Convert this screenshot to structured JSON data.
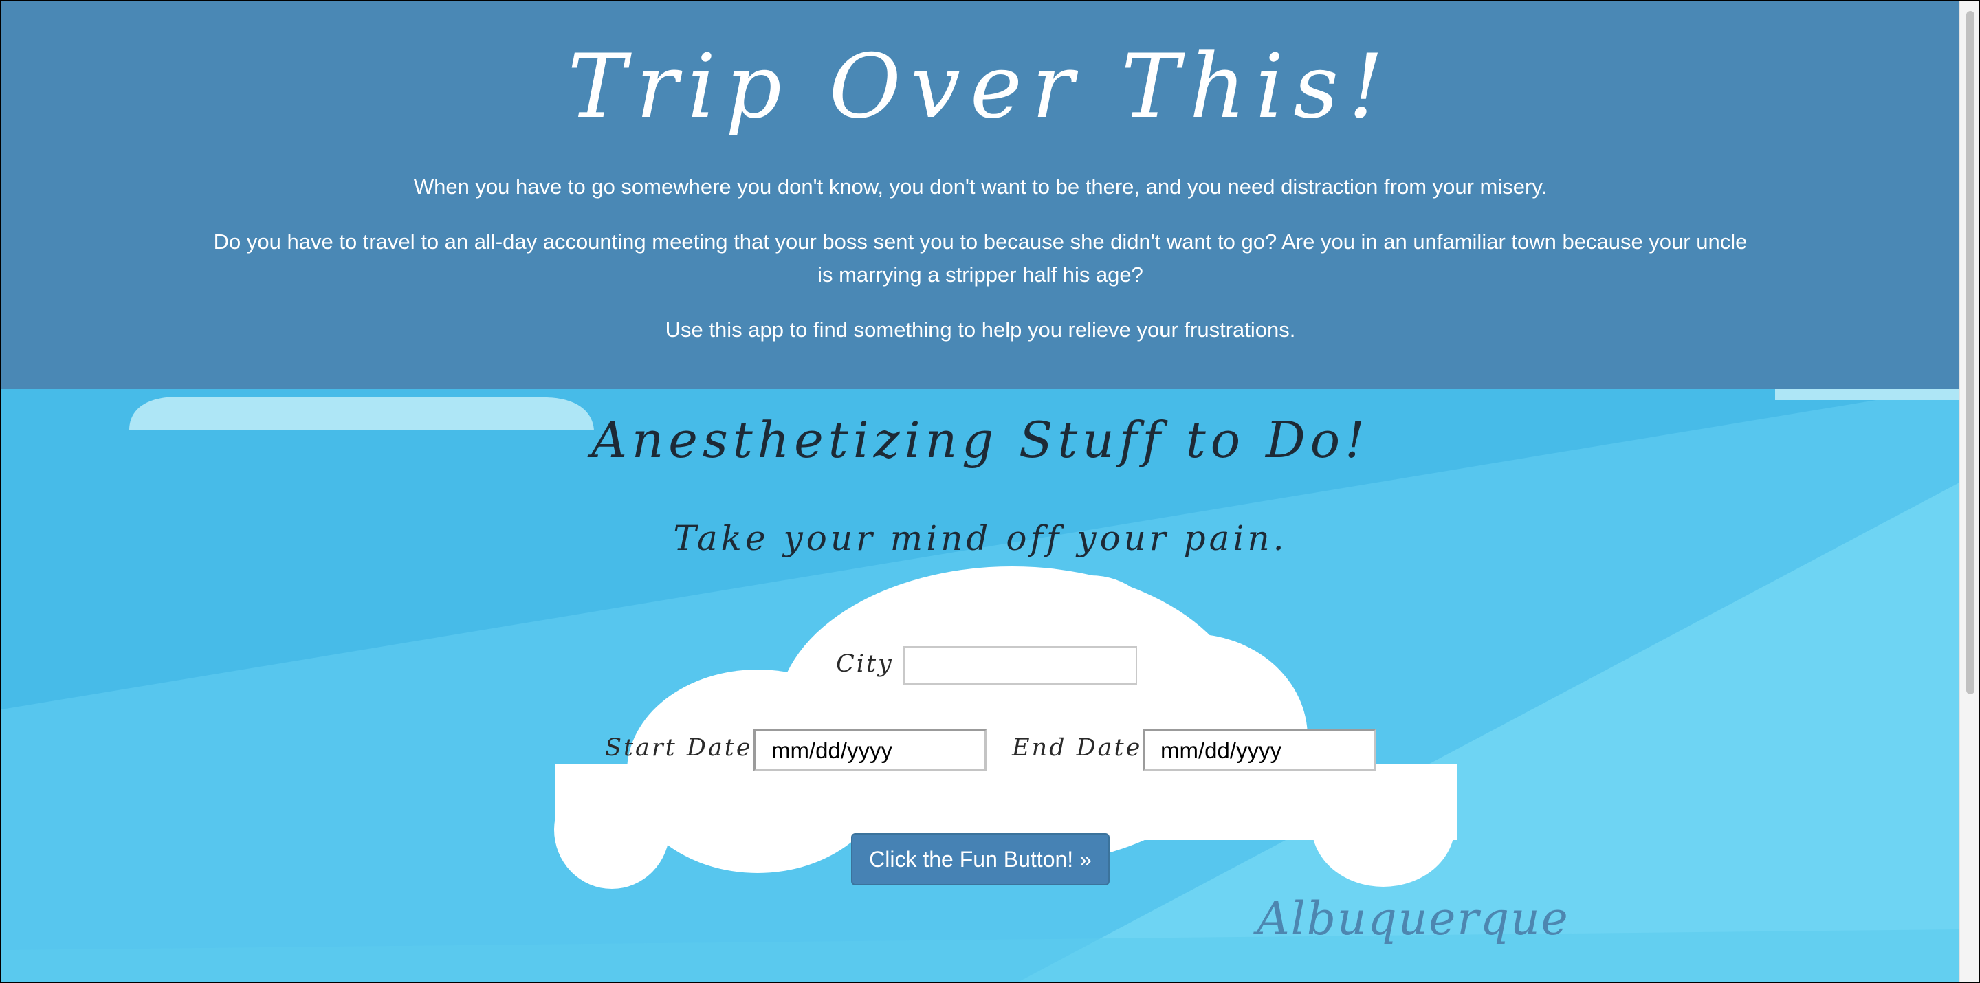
{
  "header": {
    "title": "Trip Over This!",
    "intro_1": "When you have to go somewhere you don't know, you don't want to be there, and you need distraction from your misery.",
    "intro_2": "Do you have to travel to an all-day accounting meeting that your boss sent you to because she didn't want to go? Are you in an unfamiliar town because your uncle is marrying a stripper half his age?",
    "intro_3": "Use this app to find something to help you relieve your frustrations."
  },
  "main": {
    "section_title": "Anesthetizing Stuff to Do!",
    "subtitle": "Take your mind off your pain.",
    "form": {
      "city_label": "City",
      "city_value": "",
      "start_date_label": "Start Date",
      "start_date_value": "mm/dd/yyyy",
      "end_date_label": "End Date",
      "end_date_value": "mm/dd/yyyy",
      "submit_label": "Click the Fun Button! »"
    },
    "city_caption": "Albuquerque"
  },
  "colors": {
    "header_bg": "#4a88b5",
    "sky": "#4ebde8",
    "sky_light": "#6fd5f2",
    "button_bg": "#4682b4",
    "caption": "#4d86b0"
  }
}
